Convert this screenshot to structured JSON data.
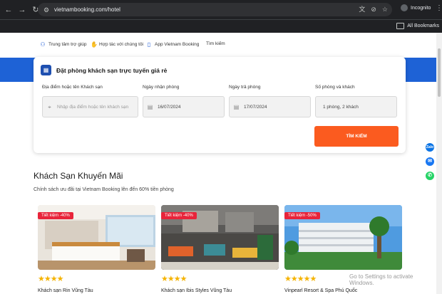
{
  "browser": {
    "url": "vietnambooking.com/hotel",
    "profile_label": "Incognito",
    "bookmarks_label": "All Bookmarks"
  },
  "topnav": {
    "items": [
      {
        "label": "Trung tâm trợ giúp",
        "icon": "user-help-icon"
      },
      {
        "label": "Hợp tác với chúng tôi",
        "icon": "handshake-icon"
      },
      {
        "label": "App Vietnam Booking",
        "icon": "mobile-app-icon"
      },
      {
        "label": "Tìm kiếm",
        "icon": ""
      }
    ]
  },
  "search_card": {
    "title": "Đặt phòng khách sạn trực tuyến giá rẻ",
    "destination_label": "Địa điểm hoặc tên Khách sạn",
    "destination_placeholder": "Nhập địa điểm hoặc tên khách sạn",
    "checkin_label": "Ngày nhận phòng",
    "checkin_value": "16/07/2024",
    "checkout_label": "Ngày trả phòng",
    "checkout_value": "17/07/2024",
    "rooms_label": "Số phòng và khách",
    "rooms_value": "1 phòng, 2 khách",
    "search_button": "TÌM KIẾM"
  },
  "promo": {
    "title": "Khách Sạn Khuyến Mãi",
    "subtitle": "Chính sách ưu đãi tại Vietnam Booking lên đến 60% tiền phòng",
    "hotels": [
      {
        "badge": "Tiết kiệm -40%",
        "stars": 4,
        "name": "Khách sạn Rin Vũng Tàu"
      },
      {
        "badge": "Tiết kiệm -40%",
        "stars": 4,
        "name": "Khách sạn Ibis Styles Vũng Tàu"
      },
      {
        "badge": "Tiết kiệm -50%",
        "stars": 5,
        "name": "Vinpearl Resort & Spa Phú Quốc"
      }
    ]
  },
  "side_buttons": [
    {
      "label": "Zalo",
      "color": "#0b74e5"
    },
    {
      "label": "",
      "icon": "messenger-icon",
      "color": "#1877f2"
    },
    {
      "label": "",
      "icon": "whatsapp-icon",
      "color": "#25d366"
    }
  ],
  "watermark": "Go to Settings to activate Windows.",
  "colors": {
    "brand_blue": "#1e62d6",
    "search_orange": "#fb5b1f",
    "badge_red": "#e8243a",
    "star": "#f5b301"
  }
}
